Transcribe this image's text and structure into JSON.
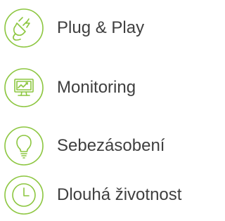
{
  "accent_color": "#8cc63f",
  "text_color": "#3f3f3f",
  "features": [
    {
      "icon": "plug-icon",
      "label": "Plug & Play"
    },
    {
      "icon": "monitor-chart-icon",
      "label": "Monitoring"
    },
    {
      "icon": "lightbulb-icon",
      "label": "Sebezásobení"
    },
    {
      "icon": "clock-icon",
      "label": "Dlouhá životnost"
    }
  ]
}
